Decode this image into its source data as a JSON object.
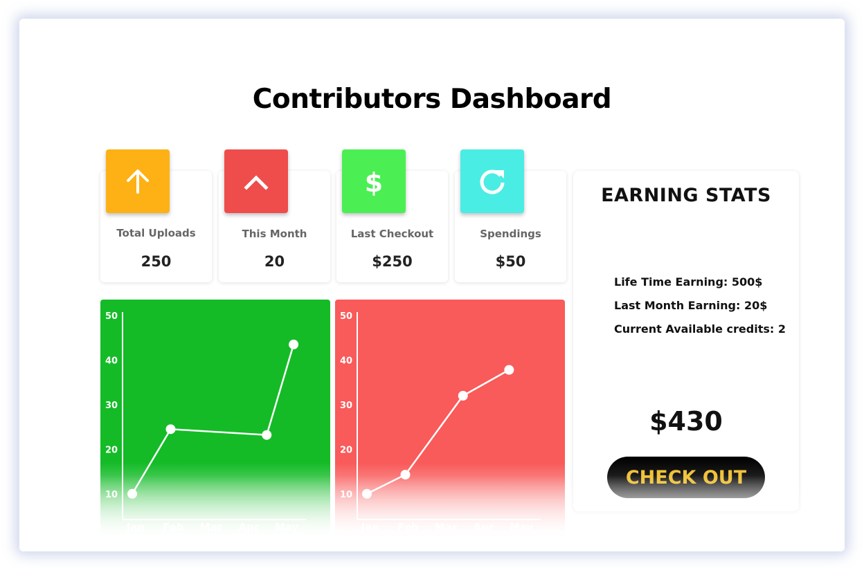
{
  "dashboard": {
    "title": "Contributors Dashboard"
  },
  "stats": [
    {
      "label": "Total Uploads",
      "value": "250",
      "icon": "arrow-up-icon",
      "color": "#fdb114"
    },
    {
      "label": "This Month",
      "value": "20",
      "icon": "chevron-up-icon",
      "color": "#ef4c4c"
    },
    {
      "label": "Last Checkout",
      "value": "$250",
      "icon": "dollar-icon",
      "color": "#4bef54"
    },
    {
      "label": "Spendings",
      "value": "$50",
      "icon": "refresh-icon",
      "color": "#4aede3"
    }
  ],
  "earning_stats": {
    "title": "EARNING STATS",
    "lines": [
      "Life Time Earning: 500$",
      "Last Month Earning: 20$",
      "Current Available credits: 2"
    ],
    "total": "$430",
    "button_label": "CHECK OUT"
  },
  "chart_data": [
    {
      "type": "line",
      "categories": [
        "Jan",
        "Feb",
        "Mar",
        "Apr",
        "May"
      ],
      "x": [
        1,
        2,
        3.5,
        4.5,
        5.2
      ],
      "values": [
        10,
        24.5,
        23,
        23.2,
        43.5
      ],
      "point_x": [
        1,
        2,
        4.5,
        5.2
      ],
      "point_y": [
        10,
        24.5,
        23.2,
        43.5
      ],
      "ylim": [
        5,
        50
      ],
      "yticks": [
        10,
        20,
        30,
        40,
        50
      ],
      "background": "#14bb27"
    },
    {
      "type": "line",
      "categories": [
        "Jan",
        "Feb",
        "Mar",
        "Apr",
        "May"
      ],
      "point_x": [
        1,
        2,
        3.5,
        4.7
      ],
      "point_y": [
        10,
        14.3,
        32,
        37.8
      ],
      "ylim": [
        5,
        50
      ],
      "yticks": [
        10,
        20,
        30,
        40,
        50
      ],
      "background": "#f95a5a"
    }
  ]
}
